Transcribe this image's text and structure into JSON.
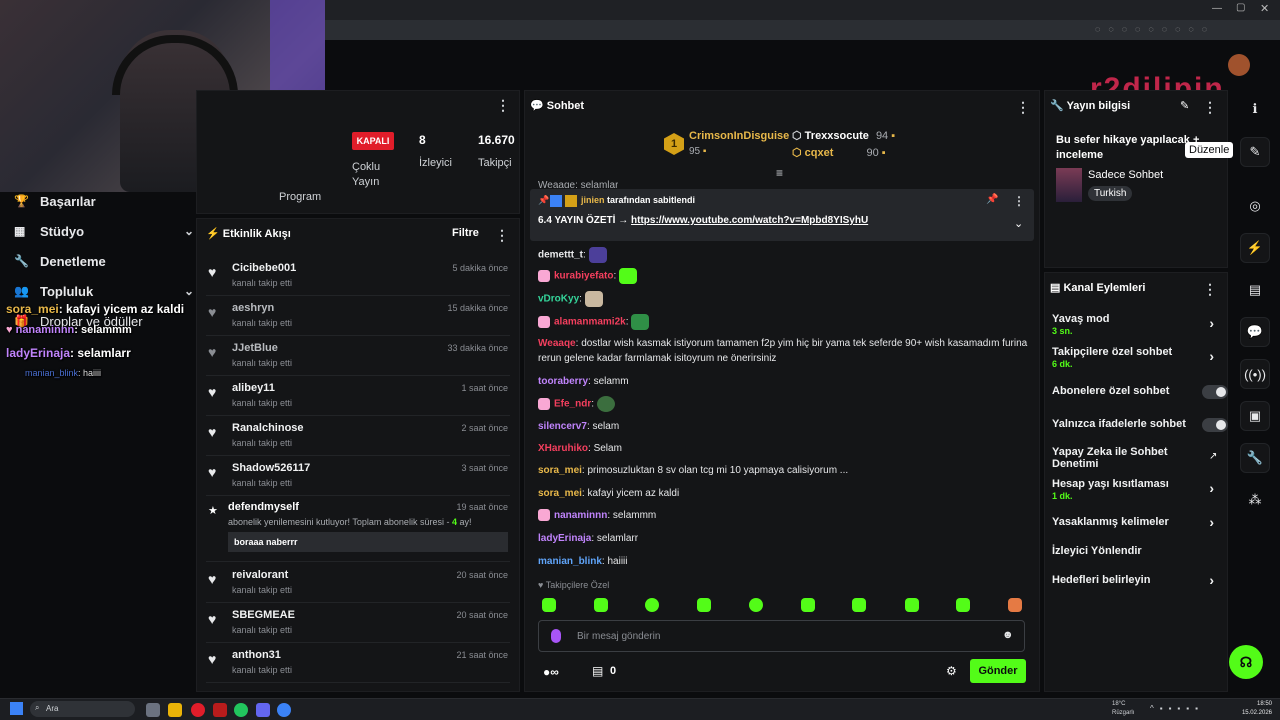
{
  "stream_header": {
    "status_badge": "KAPALI",
    "multi_stream": "Çoklu Yayın",
    "viewers_value": "8",
    "viewers_label": "İzleyici",
    "followers_value": "16.670",
    "followers_label": "Takipçi",
    "programs_label": "Program"
  },
  "sidebar": {
    "items": [
      {
        "label": "Başarılar",
        "icon": "trophy-icon"
      },
      {
        "label": "Stüdyo",
        "icon": "grid-icon"
      },
      {
        "label": "Denetleme",
        "icon": "wrench-icon"
      },
      {
        "label": "Topluluk",
        "icon": "users-icon"
      },
      {
        "label": "Droplar ve ödüller",
        "icon": "gift-icon"
      }
    ]
  },
  "overlay_chat": [
    {
      "user": "sora_mei",
      "text": ": kafayi yicem az kaldi",
      "color": "#e8b84a"
    },
    {
      "user": "nanaminnn",
      "text": ": selammm",
      "color": "#c084fc"
    },
    {
      "user": "ladyErinaja",
      "text": ": selamlarr",
      "color": "#c084fc"
    },
    {
      "user": "manian_blink",
      "text": ": haiiii",
      "color": "#4a6fd1"
    }
  ],
  "activity": {
    "title": "Etkinlik Akışı",
    "filter_label": "Filtre",
    "rows": [
      {
        "name": "Cicibebe001",
        "sub": "kanalı takip etti",
        "time": "5 dakika önce"
      },
      {
        "name": "aeshryn",
        "sub": "kanalı takip etti",
        "time": "15 dakika önce"
      },
      {
        "name": "JJetBlue",
        "sub": "kanalı takip etti",
        "time": "33 dakika önce"
      },
      {
        "name": "alibey11",
        "sub": "kanalı takip etti",
        "time": "1 saat önce"
      },
      {
        "name": "Ranalchinose",
        "sub": "kanalı takip etti",
        "time": "2 saat önce"
      },
      {
        "name": "Shadow526117",
        "sub": "kanalı takip etti",
        "time": "3 saat önce"
      }
    ],
    "sub_event": {
      "name": "defendmyself",
      "time": "19 saat önce",
      "text": "abonelik yenilemesini kutluyor! Toplam abonelik süresi - ",
      "months": "4",
      "months_suffix": " ay!",
      "message": "boraaa naberrr"
    },
    "rows2": [
      {
        "name": "reivalorant",
        "sub": "kanalı takip etti",
        "time": "20 saat önce"
      },
      {
        "name": "SBEGMEAE",
        "sub": "kanalı takip etti",
        "time": "20 saat önce"
      },
      {
        "name": "anthon31",
        "sub": "kanalı takip etti",
        "time": "21 saat önce"
      }
    ]
  },
  "chat": {
    "title": "Sohbet",
    "leaderboard": [
      {
        "name": "CrimsonInDisguise",
        "points": "95",
        "rank": "1"
      },
      {
        "name": "Trexxsocute",
        "points": "94"
      },
      {
        "name": "cqxet",
        "points": "90"
      }
    ],
    "partial_top": "Weaaqe: selamlar",
    "pinned": {
      "by_user": "jinien",
      "by_text": "tarafından sabitlendi",
      "title": "6.4 YAYIN ÖZETİ →",
      "link": "https://www.youtube.com/watch?v=Mpbd8YISyhU"
    },
    "messages": [
      {
        "user": "demettt_t",
        "text": "",
        "color": "#e6e7e9"
      },
      {
        "user": "kurabiyefato",
        "text": "",
        "color": "#f43f5e"
      },
      {
        "user": "vDroKyy",
        "text": "",
        "color": "#34d399"
      },
      {
        "user": "alamanmami2k",
        "text": "",
        "color": "#f43f5e"
      },
      {
        "user": "Weaaqe",
        "text": "dostlar wish kasmak istiyorum tamamen f2p yim hiç bir yama tek seferde 90+ wish kasamadım furina rerun gelene kadar farmlamak isitoyrum ne önerirsiniz",
        "color": "#f43f5e"
      },
      {
        "user": "tooraberry",
        "text": "selamm",
        "color": "#c084fc"
      },
      {
        "user": "Efe_ndr",
        "text": "",
        "color": "#f43f5e"
      },
      {
        "user": "silencerv7",
        "text": "selam",
        "color": "#c084fc"
      },
      {
        "user": "XHaruhiko",
        "text": "Selam",
        "color": "#f43f5e"
      },
      {
        "user": "sora_mei",
        "text": "primosuzluktan 8 sv olan tcg mi 10 yapmaya calisiyorum ...",
        "color": "#e8b84a"
      },
      {
        "user": "sora_mei",
        "text": "kafayi yicem az kaldi",
        "color": "#e8b84a"
      },
      {
        "user": "nanaminnn",
        "text": "selammm",
        "color": "#c084fc"
      },
      {
        "user": "ladyErinaja",
        "text": "selamlarr",
        "color": "#c084fc"
      },
      {
        "user": "manian_blink",
        "text": "haiiii",
        "color": "#60a5fa"
      }
    ],
    "followers_only": "Takipçilere Özel",
    "input_placeholder": "Bir mesaj gönderin",
    "points_value": "0",
    "send_label": "Gönder"
  },
  "stream_info": {
    "title": "Yayın bilgisi",
    "stream_title": "Bu sefer hikaye yapılacak + inceleme",
    "category": "Sadece Sohbet",
    "language": "Turkish",
    "tooltip": "Düzenle"
  },
  "channel_actions": {
    "title": "Kanal Eylemleri",
    "rows": [
      {
        "label": "Yavaş mod",
        "sub": "3 sn.",
        "control": "chevron"
      },
      {
        "label": "Takipçilere özel sohbet",
        "sub": "6 dk.",
        "control": "chevron"
      },
      {
        "label": "Abonelere özel sohbet",
        "sub": "",
        "control": "toggle"
      },
      {
        "label": "Yalnızca ifadelerle sohbet",
        "sub": "",
        "control": "toggle"
      },
      {
        "label": "Yapay Zeka ile Sohbet Denetimi",
        "sub": "",
        "control": "external"
      },
      {
        "label": "Hesap yaşı kısıtlaması",
        "sub": "1 dk.",
        "control": "chevron"
      },
      {
        "label": "Yasaklanmış kelimeler",
        "sub": "",
        "control": "chevron"
      },
      {
        "label": "İzleyici Yönlendir",
        "sub": "",
        "control": "none"
      },
      {
        "label": "Hedefleri belirleyin",
        "sub": "",
        "control": "chevron"
      }
    ]
  },
  "taskbar": {
    "search_label": "Ara",
    "weather_temp": "18°C",
    "weather_label": "Rüzgarlı",
    "time": "18:50",
    "date": "15.02.2026"
  },
  "colors": {
    "accent": "#53fc18",
    "bg": "#0b0c0e",
    "panel": "#141517",
    "live_red": "#e11d2a"
  }
}
